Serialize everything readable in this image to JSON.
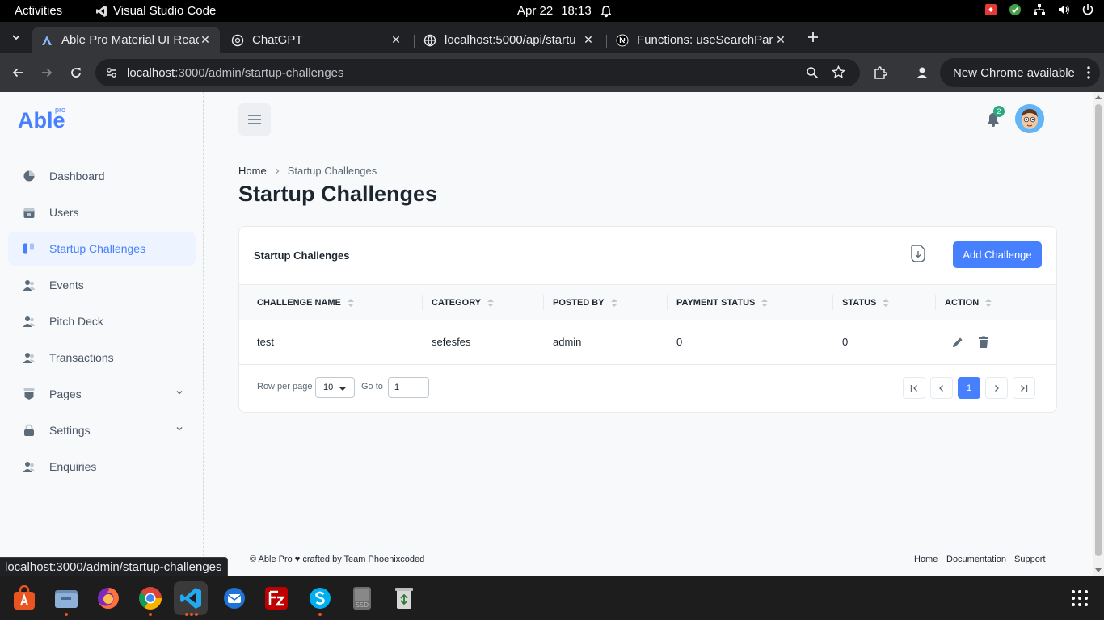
{
  "system_bar": {
    "activities": "Activities",
    "app_name": "Visual Studio Code",
    "date": "Apr 22",
    "time": "18:13"
  },
  "browser": {
    "tabs": [
      {
        "title": "Able Pro Material UI Reac",
        "active": true,
        "icon": "able-pro-favicon"
      },
      {
        "title": "ChatGPT",
        "active": false,
        "icon": "chatgpt-favicon"
      },
      {
        "title": "localhost:5000/api/startu",
        "active": false,
        "icon": "globe-favicon"
      },
      {
        "title": "Functions: useSearchPar",
        "active": false,
        "icon": "nextjs-favicon"
      }
    ],
    "url_host": "localhost",
    "url_path": ":3000/admin/startup-challenges",
    "update_button": "New Chrome available",
    "status_url": "localhost:3000/admin/startup-challenges"
  },
  "app": {
    "logo": "Able",
    "logo_sup": "pro",
    "accent_color": "#4680ff",
    "sidebar": {
      "items": [
        {
          "label": "Dashboard",
          "icon": "chart-pie-icon"
        },
        {
          "label": "Users",
          "icon": "calendar-icon"
        },
        {
          "label": "Startup Challenges",
          "icon": "kanban-icon",
          "active": true
        },
        {
          "label": "Events",
          "icon": "users-icon"
        },
        {
          "label": "Pitch Deck",
          "icon": "users-icon"
        },
        {
          "label": "Transactions",
          "icon": "users-icon"
        },
        {
          "label": "Pages",
          "icon": "document-icon",
          "expandable": true
        },
        {
          "label": "Settings",
          "icon": "lock-icon",
          "expandable": true
        },
        {
          "label": "Enquiries",
          "icon": "users-icon"
        }
      ]
    },
    "header": {
      "notification_count": "2"
    },
    "breadcrumb": {
      "home": "Home",
      "current": "Startup Challenges"
    },
    "page_title": "Startup Challenges",
    "card": {
      "title": "Startup Challenges",
      "add_button": "Add Challenge",
      "columns": [
        "CHALLENGE NAME",
        "CATEGORY",
        "POSTED BY",
        "PAYMENT STATUS",
        "STATUS",
        "ACTION"
      ],
      "rows": [
        {
          "name": "test",
          "category": "sefesfes",
          "posted_by": "admin",
          "payment_status": "0",
          "status": "0"
        }
      ],
      "pagination": {
        "rows_per_page_label": "Row per page",
        "rows_per_page": "10",
        "goto_label": "Go to",
        "goto_value": "1",
        "current_page": "1"
      }
    },
    "footer": {
      "copyright": "© Able Pro ♥ crafted by Team Phoenixcoded",
      "links": [
        "Home",
        "Documentation",
        "Support"
      ]
    }
  }
}
